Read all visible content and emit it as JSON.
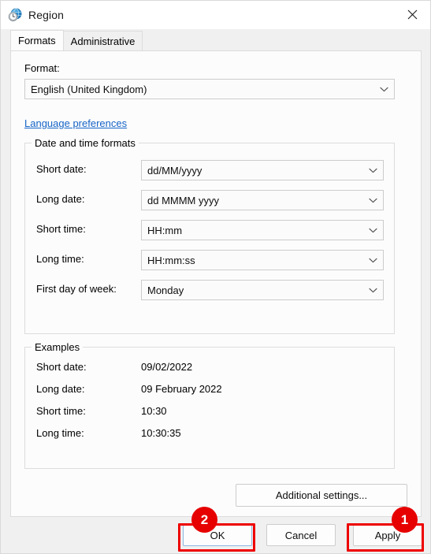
{
  "window": {
    "title": "Region",
    "icon": "region-globe-clock-icon",
    "close_label": "✕"
  },
  "tabs": [
    {
      "label": "Formats",
      "selected": true
    },
    {
      "label": "Administrative",
      "selected": false
    }
  ],
  "format_section": {
    "label": "Format:",
    "value": "English (United Kingdom)",
    "language_preferences_link": "Language preferences"
  },
  "datetime_group": {
    "legend": "Date and time formats",
    "rows": [
      {
        "label": "Short date:",
        "value": "dd/MM/yyyy"
      },
      {
        "label": "Long date:",
        "value": "dd MMMM yyyy"
      },
      {
        "label": "Short time:",
        "value": "HH:mm"
      },
      {
        "label": "Long time:",
        "value": "HH:mm:ss"
      },
      {
        "label": "First day of week:",
        "value": "Monday"
      }
    ]
  },
  "examples_group": {
    "legend": "Examples",
    "rows": [
      {
        "label": "Short date:",
        "value": "09/02/2022"
      },
      {
        "label": "Long date:",
        "value": "09 February 2022"
      },
      {
        "label": "Short time:",
        "value": "10:30"
      },
      {
        "label": "Long time:",
        "value": "10:30:35"
      }
    ]
  },
  "buttons": {
    "additional_settings": "Additional settings...",
    "ok": "OK",
    "cancel": "Cancel",
    "apply": "Apply"
  },
  "annotations": [
    {
      "number": "1",
      "target": "apply-button"
    },
    {
      "number": "2",
      "target": "ok-button"
    }
  ],
  "colors": {
    "annotation_red": "#e60000",
    "link_blue": "#1664c8",
    "default_button_border": "#8cb7e0"
  }
}
